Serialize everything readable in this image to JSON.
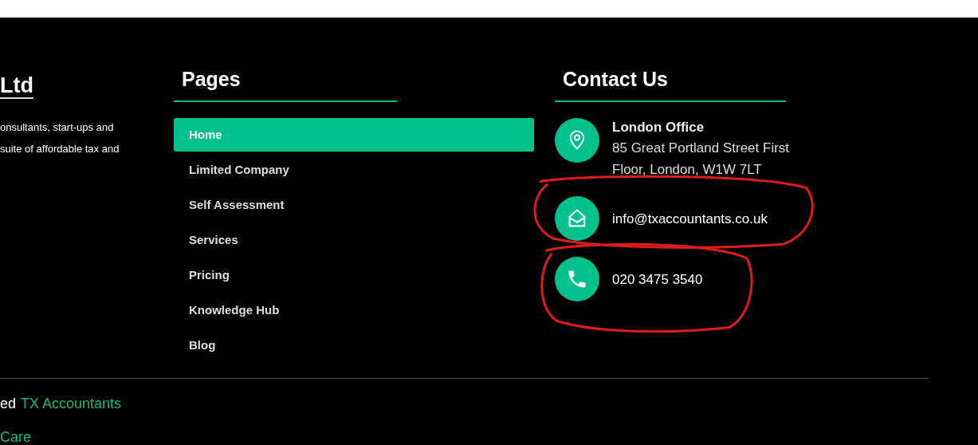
{
  "about": {
    "title": "Ltd",
    "lines": [
      "onsultants, start-ups and",
      "suite of affordable tax and"
    ]
  },
  "pages": {
    "heading": "Pages",
    "items": [
      {
        "label": "Home",
        "selected": true
      },
      {
        "label": "Limited Company",
        "selected": false
      },
      {
        "label": "Self Assessment",
        "selected": false
      },
      {
        "label": "Services",
        "selected": false
      },
      {
        "label": "Pricing",
        "selected": false
      },
      {
        "label": "Knowledge Hub",
        "selected": false
      },
      {
        "label": "Blog",
        "selected": false
      }
    ]
  },
  "contact": {
    "heading": "Contact Us",
    "items": [
      {
        "kind": "location",
        "title": "London Office",
        "text": "85 Great Portland Street First Floor, London, W1W 7LT",
        "circled": false
      },
      {
        "kind": "email",
        "text": "info@txaccountants.co.uk",
        "circled": true
      },
      {
        "kind": "phone",
        "text": "020 3475 3540",
        "circled": true
      }
    ]
  },
  "bottom": {
    "prefix": "ed",
    "link": "TX Accountants",
    "second_link": "Care"
  }
}
